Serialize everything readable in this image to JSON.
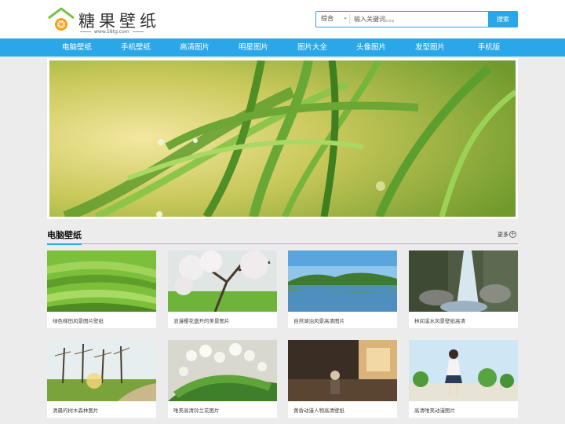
{
  "logo": {
    "title": "糖果壁纸",
    "url_text": "www.58tg.com"
  },
  "search": {
    "category": "综合",
    "placeholder": "输入关键词。。。",
    "button": "搜索"
  },
  "nav": [
    "电脑壁纸",
    "手机壁纸",
    "高清图片",
    "明星图片",
    "图片大全",
    "头像图片",
    "发型图片",
    "手机版"
  ],
  "section": {
    "title": "电脑壁纸",
    "more": "更多"
  },
  "cards": [
    "绿色梯田风景图片壁纸",
    "浪漫樱花盛开的美景图片",
    "自然湖泊风景高清图片",
    "林间溪水风景壁纸高清",
    "清晨的树木森林图片",
    "唯美高清铃兰花图片",
    "黄昏动漫人物高清壁纸",
    "高清唯美动漫图片"
  ],
  "colors": {
    "accent": "#2aa7e8",
    "background": "#ececec",
    "section_line": "#c7a3c7"
  }
}
